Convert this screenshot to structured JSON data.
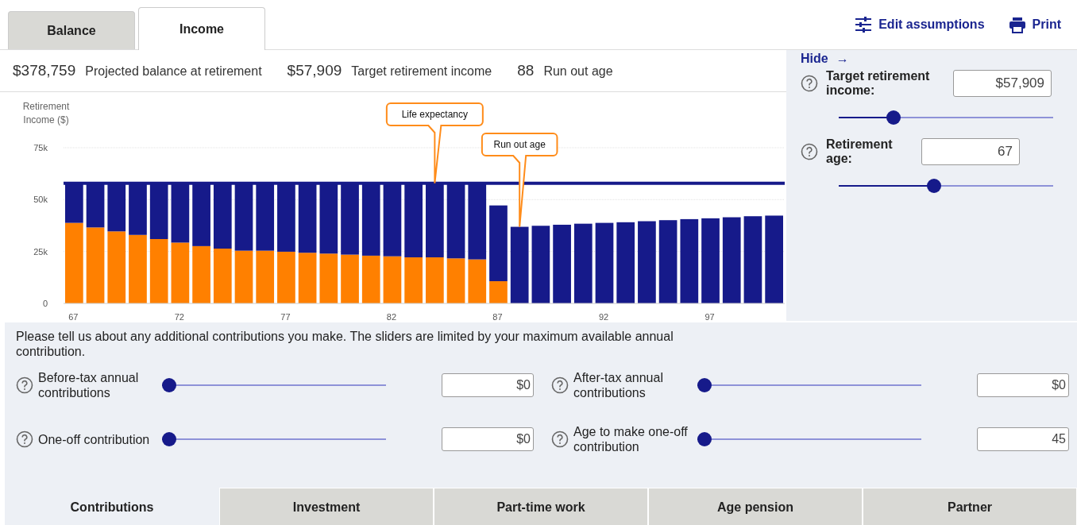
{
  "tabs": [
    {
      "label": "Balance",
      "selected": false
    },
    {
      "label": "Income",
      "selected": true
    }
  ],
  "actions": [
    {
      "kind": "settings",
      "label": "Edit assumptions"
    },
    {
      "kind": "print",
      "label": "Print"
    }
  ],
  "summary": [
    {
      "value": "$378,759",
      "label": "Projected balance at retirement"
    },
    {
      "value": "$57,909",
      "label": "Target retirement income"
    },
    {
      "value": "88",
      "label": "Run out age"
    }
  ],
  "chart": {
    "chart_data": {
      "type": "bar",
      "stacked": true,
      "ylabel": "Retirement Income ($)",
      "grid": true,
      "x": [
        67,
        68,
        69,
        70,
        71,
        72,
        73,
        74,
        75,
        76,
        77,
        78,
        79,
        80,
        81,
        82,
        83,
        84,
        85,
        86,
        87,
        88,
        89,
        90,
        91,
        92,
        93,
        94,
        95,
        96,
        97,
        98,
        99,
        100
      ],
      "series": [
        {
          "color": "#ff8000",
          "values": [
            38800,
            36600,
            34700,
            33000,
            31000,
            29300,
            27600,
            26400,
            25400,
            25400,
            24900,
            24400,
            24000,
            23500,
            23000,
            22700,
            22200,
            22200,
            21700,
            21200,
            10700,
            null,
            null,
            null,
            null,
            null,
            null,
            null,
            null,
            null,
            null,
            null,
            null,
            null
          ]
        },
        {
          "color": "#161a8a",
          "values": [
            19100,
            21300,
            23200,
            24900,
            26900,
            28600,
            30300,
            31500,
            32500,
            32500,
            33000,
            33500,
            33900,
            34400,
            34900,
            35200,
            35700,
            35700,
            36200,
            36700,
            36500,
            36900,
            37400,
            37900,
            38400,
            38800,
            39100,
            39600,
            40100,
            40600,
            41000,
            41500,
            42000,
            42300
          ]
        }
      ],
      "xticks": [
        67,
        72,
        77,
        82,
        87,
        92,
        97
      ],
      "xlim": [
        66.5,
        100.5
      ],
      "ylim": [
        0,
        75000
      ],
      "yticks": [
        {
          "value": 0,
          "label": "0"
        },
        {
          "value": 25000,
          "label": "25k"
        },
        {
          "value": 50000,
          "label": "50k"
        },
        {
          "value": 75000,
          "label": "75k"
        }
      ],
      "ref_lines": [
        {
          "axis": "y",
          "value": 57909,
          "color": "#161a8a"
        }
      ],
      "annotations": [
        "Life expectancy",
        "Run out age"
      ]
    }
  },
  "side_panel": {
    "hide_link": "Hide",
    "hide_arrow": "→",
    "fields": [
      {
        "label": "Target retirement income:",
        "value": "$57,909",
        "level": 0.24
      },
      {
        "label": "Retirement age:",
        "value": "67",
        "level": 0.44
      }
    ]
  },
  "contributions": {
    "intro": "Please tell us about any additional contributions you make. The sliders are limited by your maximum available annual contribution.",
    "fields": [
      {
        "label": "Before-tax annual contributions",
        "value": "$0",
        "level": 0
      },
      {
        "label": "After-tax annual contributions",
        "value": "$0",
        "level": 0
      },
      {
        "label": "One-off contribution",
        "value": "$0",
        "level": 0
      },
      {
        "label": "Age to make one-off contribution",
        "value": "45",
        "level": 0
      }
    ]
  },
  "bottom_tabs": [
    {
      "label": "Contributions",
      "selected": true
    },
    {
      "label": "Investment",
      "selected": false
    },
    {
      "label": "Part-time work",
      "selected": false
    },
    {
      "label": "Age pension",
      "selected": false
    },
    {
      "label": "Partner",
      "selected": false
    }
  ]
}
